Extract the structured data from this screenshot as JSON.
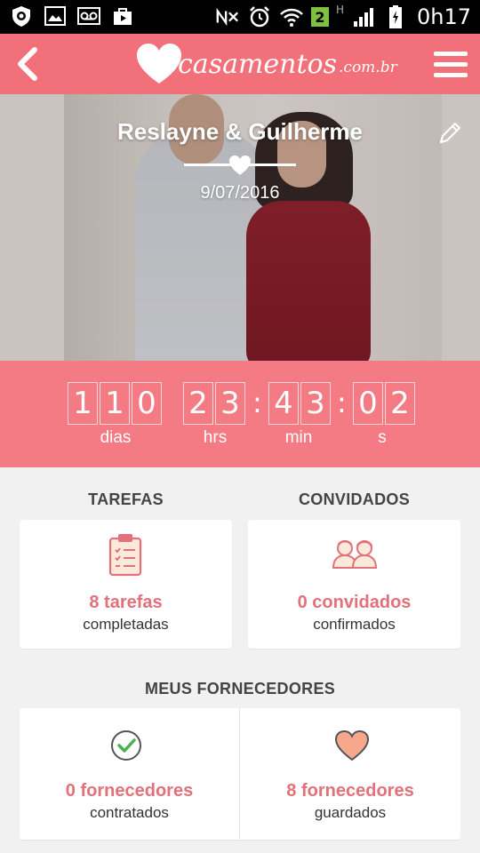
{
  "status_bar": {
    "time": "0h17",
    "notification_badge": "2",
    "network_label": "H",
    "left_icons": [
      "shield-icon",
      "gallery-icon",
      "voicemail-icon",
      "play-store-icon"
    ],
    "right_icons": [
      "nfc-muted-icon",
      "alarm-icon",
      "wifi-icon",
      "signal-icon",
      "battery-charging-icon"
    ]
  },
  "app_bar": {
    "logo_text": "casamentos",
    "logo_suffix": ".com.br",
    "accent_color": "#f1707a"
  },
  "hero": {
    "couple_name": "Reslayne & Guilherme",
    "date": "9/07/2016"
  },
  "countdown": {
    "days_digits": [
      "1",
      "1",
      "0"
    ],
    "hours_digits": [
      "2",
      "3"
    ],
    "minutes_digits": [
      "4",
      "3"
    ],
    "seconds_digits": [
      "0",
      "2"
    ],
    "labels": {
      "days": "dias",
      "hours": "hrs",
      "minutes": "min",
      "seconds": "s"
    },
    "separator": ":"
  },
  "tasks": {
    "title": "TAREFAS",
    "value": "8 tarefas",
    "caption": "completadas"
  },
  "guests": {
    "title": "CONVIDADOS",
    "value": "0 convidados",
    "caption": "confirmados"
  },
  "vendors": {
    "title": "MEUS FORNECEDORES",
    "hired": {
      "value": "0 fornecedores",
      "caption": "contratados"
    },
    "saved": {
      "value": "8 fornecedores",
      "caption": "guardados"
    }
  }
}
